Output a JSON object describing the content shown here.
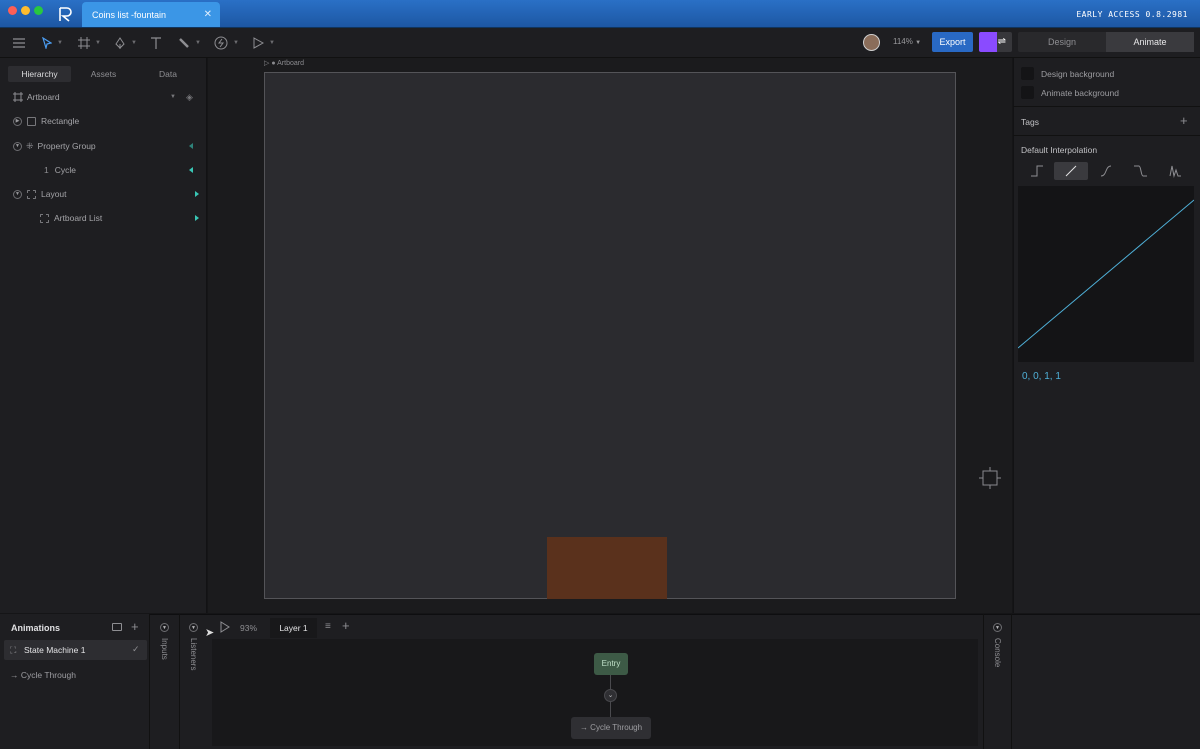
{
  "window": {
    "tab_title": "Coins list -fountain",
    "build": "EARLY ACCESS 0.8.2981"
  },
  "toolbar": {
    "zoom": "114%",
    "export_label": "Export",
    "mode_design": "Design",
    "mode_animate": "Animate"
  },
  "left_panel": {
    "tabs": [
      "Hierarchy",
      "Assets",
      "Data"
    ],
    "tree": [
      {
        "label": "Artboard"
      },
      {
        "label": "Rectangle"
      },
      {
        "label": "Property Group"
      },
      {
        "index": "1",
        "label": "Cycle"
      },
      {
        "label": "Layout"
      },
      {
        "label": "Artboard List"
      }
    ]
  },
  "canvas": {
    "artboard_label": "Artboard"
  },
  "right_panel": {
    "design_bg": "Design background",
    "animate_bg": "Animate background",
    "tags": "Tags",
    "interp_title": "Default Interpolation",
    "interp_values": "0, 0, 1, 1"
  },
  "bottom": {
    "animations_title": "Animations",
    "state_machine": "State Machine 1",
    "animation_item": "Cycle Through",
    "inputs": "Inputs",
    "listeners": "Listeners",
    "zoom": "93%",
    "layer": "Layer 1",
    "console": "Console",
    "node_entry": "Entry",
    "node_cycle": "Cycle Through"
  },
  "colors": {
    "accent": "#2969c4",
    "artboard": "#2b2b2f",
    "rectangle": "#5a311c",
    "teal": "#39c6b5"
  }
}
